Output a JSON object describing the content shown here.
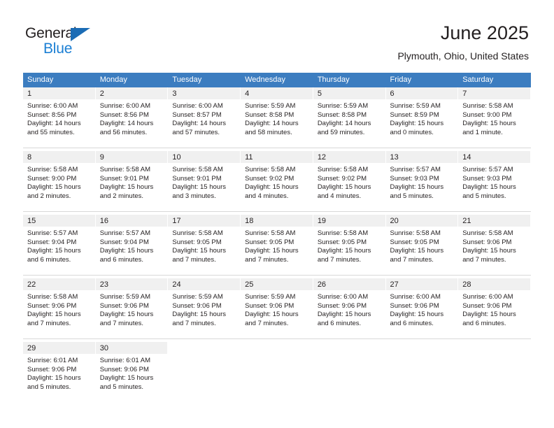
{
  "logo": {
    "primary_text": "General",
    "secondary_text": "Blue",
    "triangle_icon": "triangle-icon",
    "primary_color": "#231f20",
    "secondary_color": "#1b7fd4",
    "triangle_color": "#1b6cb5"
  },
  "header": {
    "title": "June 2025",
    "subtitle": "Plymouth, Ohio, United States"
  },
  "theme": {
    "header_row_bg": "#3c7dc0",
    "header_row_text": "#ffffff",
    "day_band_bg": "#f0f0f0",
    "body_text": "#231f20"
  },
  "weekdays": [
    "Sunday",
    "Monday",
    "Tuesday",
    "Wednesday",
    "Thursday",
    "Friday",
    "Saturday"
  ],
  "weeks": [
    [
      {
        "day": "1",
        "sunrise": "Sunrise: 6:00 AM",
        "sunset": "Sunset: 8:56 PM",
        "daylight_line1": "Daylight: 14 hours",
        "daylight_line2": "and 55 minutes."
      },
      {
        "day": "2",
        "sunrise": "Sunrise: 6:00 AM",
        "sunset": "Sunset: 8:56 PM",
        "daylight_line1": "Daylight: 14 hours",
        "daylight_line2": "and 56 minutes."
      },
      {
        "day": "3",
        "sunrise": "Sunrise: 6:00 AM",
        "sunset": "Sunset: 8:57 PM",
        "daylight_line1": "Daylight: 14 hours",
        "daylight_line2": "and 57 minutes."
      },
      {
        "day": "4",
        "sunrise": "Sunrise: 5:59 AM",
        "sunset": "Sunset: 8:58 PM",
        "daylight_line1": "Daylight: 14 hours",
        "daylight_line2": "and 58 minutes."
      },
      {
        "day": "5",
        "sunrise": "Sunrise: 5:59 AM",
        "sunset": "Sunset: 8:58 PM",
        "daylight_line1": "Daylight: 14 hours",
        "daylight_line2": "and 59 minutes."
      },
      {
        "day": "6",
        "sunrise": "Sunrise: 5:59 AM",
        "sunset": "Sunset: 8:59 PM",
        "daylight_line1": "Daylight: 15 hours",
        "daylight_line2": "and 0 minutes."
      },
      {
        "day": "7",
        "sunrise": "Sunrise: 5:58 AM",
        "sunset": "Sunset: 9:00 PM",
        "daylight_line1": "Daylight: 15 hours",
        "daylight_line2": "and 1 minute."
      }
    ],
    [
      {
        "day": "8",
        "sunrise": "Sunrise: 5:58 AM",
        "sunset": "Sunset: 9:00 PM",
        "daylight_line1": "Daylight: 15 hours",
        "daylight_line2": "and 2 minutes."
      },
      {
        "day": "9",
        "sunrise": "Sunrise: 5:58 AM",
        "sunset": "Sunset: 9:01 PM",
        "daylight_line1": "Daylight: 15 hours",
        "daylight_line2": "and 2 minutes."
      },
      {
        "day": "10",
        "sunrise": "Sunrise: 5:58 AM",
        "sunset": "Sunset: 9:01 PM",
        "daylight_line1": "Daylight: 15 hours",
        "daylight_line2": "and 3 minutes."
      },
      {
        "day": "11",
        "sunrise": "Sunrise: 5:58 AM",
        "sunset": "Sunset: 9:02 PM",
        "daylight_line1": "Daylight: 15 hours",
        "daylight_line2": "and 4 minutes."
      },
      {
        "day": "12",
        "sunrise": "Sunrise: 5:58 AM",
        "sunset": "Sunset: 9:02 PM",
        "daylight_line1": "Daylight: 15 hours",
        "daylight_line2": "and 4 minutes."
      },
      {
        "day": "13",
        "sunrise": "Sunrise: 5:57 AM",
        "sunset": "Sunset: 9:03 PM",
        "daylight_line1": "Daylight: 15 hours",
        "daylight_line2": "and 5 minutes."
      },
      {
        "day": "14",
        "sunrise": "Sunrise: 5:57 AM",
        "sunset": "Sunset: 9:03 PM",
        "daylight_line1": "Daylight: 15 hours",
        "daylight_line2": "and 5 minutes."
      }
    ],
    [
      {
        "day": "15",
        "sunrise": "Sunrise: 5:57 AM",
        "sunset": "Sunset: 9:04 PM",
        "daylight_line1": "Daylight: 15 hours",
        "daylight_line2": "and 6 minutes."
      },
      {
        "day": "16",
        "sunrise": "Sunrise: 5:57 AM",
        "sunset": "Sunset: 9:04 PM",
        "daylight_line1": "Daylight: 15 hours",
        "daylight_line2": "and 6 minutes."
      },
      {
        "day": "17",
        "sunrise": "Sunrise: 5:58 AM",
        "sunset": "Sunset: 9:05 PM",
        "daylight_line1": "Daylight: 15 hours",
        "daylight_line2": "and 7 minutes."
      },
      {
        "day": "18",
        "sunrise": "Sunrise: 5:58 AM",
        "sunset": "Sunset: 9:05 PM",
        "daylight_line1": "Daylight: 15 hours",
        "daylight_line2": "and 7 minutes."
      },
      {
        "day": "19",
        "sunrise": "Sunrise: 5:58 AM",
        "sunset": "Sunset: 9:05 PM",
        "daylight_line1": "Daylight: 15 hours",
        "daylight_line2": "and 7 minutes."
      },
      {
        "day": "20",
        "sunrise": "Sunrise: 5:58 AM",
        "sunset": "Sunset: 9:05 PM",
        "daylight_line1": "Daylight: 15 hours",
        "daylight_line2": "and 7 minutes."
      },
      {
        "day": "21",
        "sunrise": "Sunrise: 5:58 AM",
        "sunset": "Sunset: 9:06 PM",
        "daylight_line1": "Daylight: 15 hours",
        "daylight_line2": "and 7 minutes."
      }
    ],
    [
      {
        "day": "22",
        "sunrise": "Sunrise: 5:58 AM",
        "sunset": "Sunset: 9:06 PM",
        "daylight_line1": "Daylight: 15 hours",
        "daylight_line2": "and 7 minutes."
      },
      {
        "day": "23",
        "sunrise": "Sunrise: 5:59 AM",
        "sunset": "Sunset: 9:06 PM",
        "daylight_line1": "Daylight: 15 hours",
        "daylight_line2": "and 7 minutes."
      },
      {
        "day": "24",
        "sunrise": "Sunrise: 5:59 AM",
        "sunset": "Sunset: 9:06 PM",
        "daylight_line1": "Daylight: 15 hours",
        "daylight_line2": "and 7 minutes."
      },
      {
        "day": "25",
        "sunrise": "Sunrise: 5:59 AM",
        "sunset": "Sunset: 9:06 PM",
        "daylight_line1": "Daylight: 15 hours",
        "daylight_line2": "and 7 minutes."
      },
      {
        "day": "26",
        "sunrise": "Sunrise: 6:00 AM",
        "sunset": "Sunset: 9:06 PM",
        "daylight_line1": "Daylight: 15 hours",
        "daylight_line2": "and 6 minutes."
      },
      {
        "day": "27",
        "sunrise": "Sunrise: 6:00 AM",
        "sunset": "Sunset: 9:06 PM",
        "daylight_line1": "Daylight: 15 hours",
        "daylight_line2": "and 6 minutes."
      },
      {
        "day": "28",
        "sunrise": "Sunrise: 6:00 AM",
        "sunset": "Sunset: 9:06 PM",
        "daylight_line1": "Daylight: 15 hours",
        "daylight_line2": "and 6 minutes."
      }
    ],
    [
      {
        "day": "29",
        "sunrise": "Sunrise: 6:01 AM",
        "sunset": "Sunset: 9:06 PM",
        "daylight_line1": "Daylight: 15 hours",
        "daylight_line2": "and 5 minutes."
      },
      {
        "day": "30",
        "sunrise": "Sunrise: 6:01 AM",
        "sunset": "Sunset: 9:06 PM",
        "daylight_line1": "Daylight: 15 hours",
        "daylight_line2": "and 5 minutes."
      },
      {
        "day": "",
        "sunrise": "",
        "sunset": "",
        "daylight_line1": "",
        "daylight_line2": ""
      },
      {
        "day": "",
        "sunrise": "",
        "sunset": "",
        "daylight_line1": "",
        "daylight_line2": ""
      },
      {
        "day": "",
        "sunrise": "",
        "sunset": "",
        "daylight_line1": "",
        "daylight_line2": ""
      },
      {
        "day": "",
        "sunrise": "",
        "sunset": "",
        "daylight_line1": "",
        "daylight_line2": ""
      },
      {
        "day": "",
        "sunrise": "",
        "sunset": "",
        "daylight_line1": "",
        "daylight_line2": ""
      }
    ]
  ]
}
